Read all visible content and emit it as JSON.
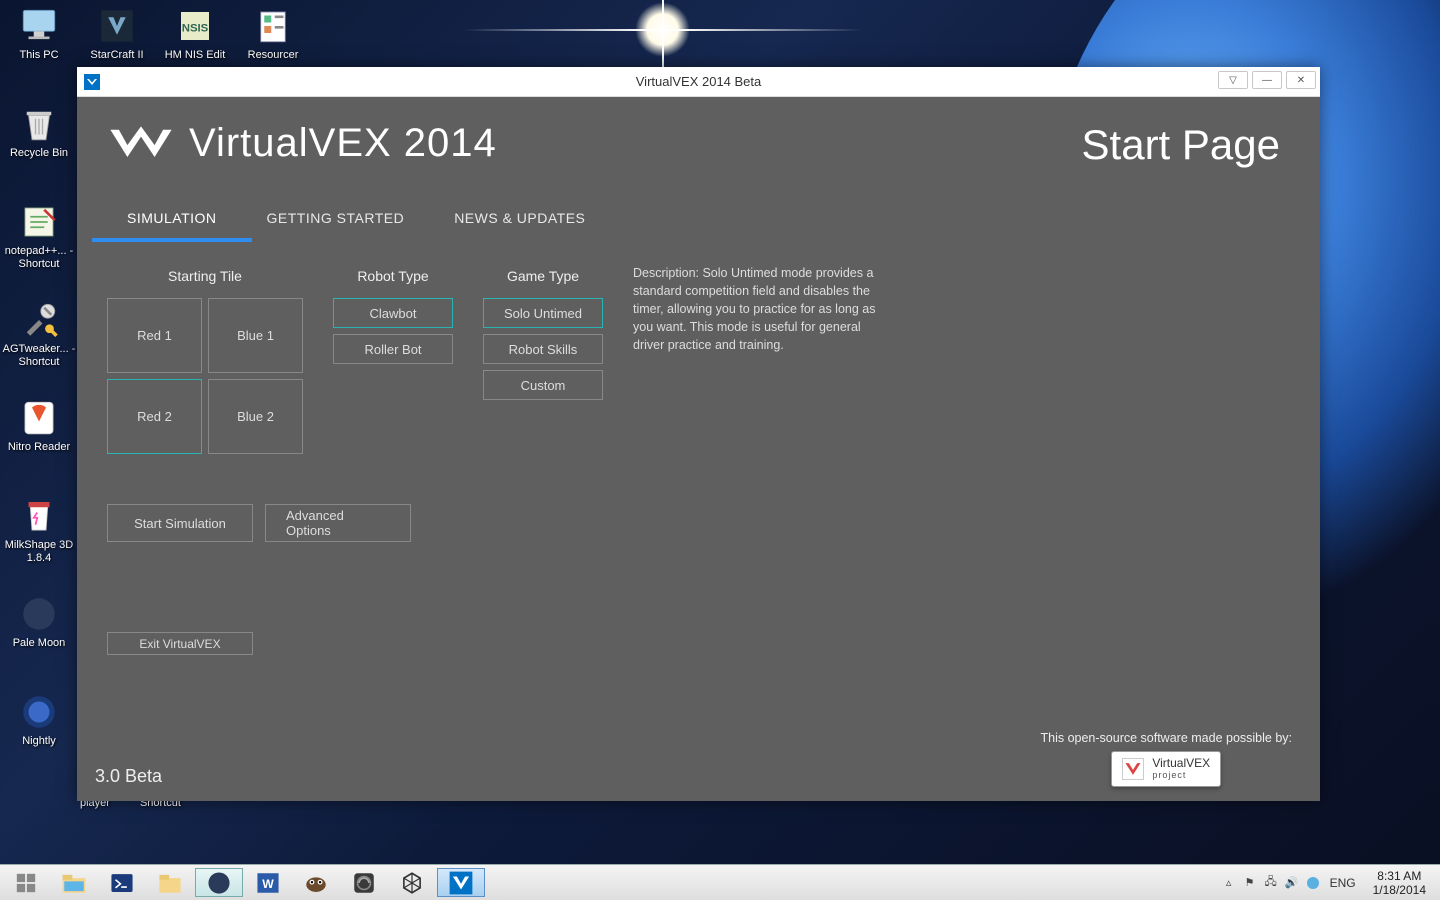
{
  "desktop_icons_col1": [
    {
      "label": "This PC"
    },
    {
      "label": "Recycle Bin"
    },
    {
      "label": "notepad++... - Shortcut"
    },
    {
      "label": "AGTweaker... - Shortcut"
    },
    {
      "label": "Nitro Reader"
    },
    {
      "label": "MilkShape 3D 1.8.4"
    },
    {
      "label": "Pale Moon"
    },
    {
      "label": "Nightly"
    }
  ],
  "desktop_icons_top": [
    {
      "label": "StarCraft II"
    },
    {
      "label": "HM NIS Edit"
    },
    {
      "label": "Resourcer"
    }
  ],
  "window": {
    "title": "VirtualVEX 2014 Beta",
    "brand": "VirtualVEX 2014",
    "page_title": "Start Page",
    "tabs": [
      "SIMULATION",
      "GETTING STARTED",
      "NEWS & UPDATES"
    ],
    "starting_tile": {
      "title": "Starting Tile",
      "options": [
        "Red 1",
        "Blue 1",
        "Red 2",
        "Blue 2"
      ],
      "selected": "Red 2"
    },
    "robot_type": {
      "title": "Robot Type",
      "options": [
        "Clawbot",
        "Roller Bot"
      ],
      "selected": "Clawbot"
    },
    "game_type": {
      "title": "Game Type",
      "options": [
        "Solo Untimed",
        "Robot Skills",
        "Custom"
      ],
      "selected": "Solo Untimed"
    },
    "description": "Description: Solo Untimed mode provides a standard competition field and disables the timer, allowing you to practice for as long as you want. This mode is useful for general driver practice and training.",
    "buttons": {
      "start": "Start Simulation",
      "advanced": "Advanced Options",
      "exit": "Exit VirtualVEX"
    },
    "version": "3.0 Beta",
    "sponsor_text": "This open-source software made possible by:",
    "sponsor_badge_line1": "VirtualVEX",
    "sponsor_badge_line2": "project"
  },
  "below_desktop_labels": [
    "player",
    "Shortcut"
  ],
  "taskbar": {
    "tray_lang": "ENG",
    "clock_time": "8:31 AM",
    "clock_date": "1/18/2014"
  }
}
